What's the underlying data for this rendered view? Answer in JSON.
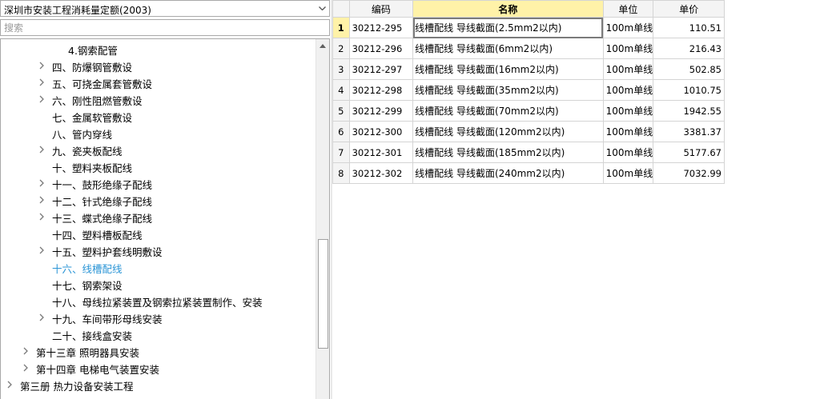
{
  "left": {
    "quota_selector": {
      "value": "深圳市安装工程消耗量定额(2003)"
    },
    "search": {
      "placeholder": "搜索",
      "value": ""
    },
    "tree": [
      {
        "label": "4.钢索配管",
        "level": 4,
        "expandable": false,
        "selected": false
      },
      {
        "label": "四、防爆钢管敷设",
        "level": 3,
        "expandable": true,
        "selected": false
      },
      {
        "label": "五、可挠金属套管敷设",
        "level": 3,
        "expandable": true,
        "selected": false
      },
      {
        "label": "六、刚性阻燃管敷设",
        "level": 3,
        "expandable": true,
        "selected": false
      },
      {
        "label": "七、金属软管敷设",
        "level": 3,
        "expandable": false,
        "selected": false
      },
      {
        "label": "八、管内穿线",
        "level": 3,
        "expandable": false,
        "selected": false
      },
      {
        "label": "九、瓷夹板配线",
        "level": 3,
        "expandable": true,
        "selected": false
      },
      {
        "label": "十、塑料夹板配线",
        "level": 3,
        "expandable": false,
        "selected": false
      },
      {
        "label": "十一、鼓形绝缘子配线",
        "level": 3,
        "expandable": true,
        "selected": false
      },
      {
        "label": "十二、针式绝缘子配线",
        "level": 3,
        "expandable": true,
        "selected": false
      },
      {
        "label": "十三、蝶式绝缘子配线",
        "level": 3,
        "expandable": true,
        "selected": false
      },
      {
        "label": "十四、塑料槽板配线",
        "level": 3,
        "expandable": false,
        "selected": false
      },
      {
        "label": "十五、塑料护套线明敷设",
        "level": 3,
        "expandable": true,
        "selected": false
      },
      {
        "label": "十六、线槽配线",
        "level": 3,
        "expandable": false,
        "selected": true
      },
      {
        "label": "十七、钢索架设",
        "level": 3,
        "expandable": false,
        "selected": false
      },
      {
        "label": "十八、母线拉紧装置及钢索拉紧装置制作、安装",
        "level": 3,
        "expandable": false,
        "selected": false
      },
      {
        "label": "十九、车间带形母线安装",
        "level": 3,
        "expandable": true,
        "selected": false
      },
      {
        "label": "二十、接线盒安装",
        "level": 3,
        "expandable": false,
        "selected": false
      },
      {
        "label": "第十三章 照明器具安装",
        "level": 2,
        "expandable": true,
        "selected": false
      },
      {
        "label": "第十四章 电梯电气装置安装",
        "level": 2,
        "expandable": true,
        "selected": false
      },
      {
        "label": "第三册 热力设备安装工程",
        "level": 1,
        "expandable": true,
        "selected": false
      }
    ]
  },
  "grid": {
    "headers": {
      "code": "编码",
      "name": "名称",
      "unit": "单位",
      "price": "单价"
    },
    "active_row": 1,
    "rows": [
      {
        "num": "1",
        "code": "30212-295",
        "name": "线槽配线 导线截面(2.5mm2以内)",
        "unit": "100m单线",
        "price": "110.51"
      },
      {
        "num": "2",
        "code": "30212-296",
        "name": "线槽配线 导线截面(6mm2以内)",
        "unit": "100m单线",
        "price": "216.43"
      },
      {
        "num": "3",
        "code": "30212-297",
        "name": "线槽配线 导线截面(16mm2以内)",
        "unit": "100m单线",
        "price": "502.85"
      },
      {
        "num": "4",
        "code": "30212-298",
        "name": "线槽配线 导线截面(35mm2以内)",
        "unit": "100m单线",
        "price": "1010.75"
      },
      {
        "num": "5",
        "code": "30212-299",
        "name": "线槽配线 导线截面(70mm2以内)",
        "unit": "100m单线",
        "price": "1942.55"
      },
      {
        "num": "6",
        "code": "30212-300",
        "name": "线槽配线 导线截面(120mm2以内)",
        "unit": "100m单线",
        "price": "3381.37"
      },
      {
        "num": "7",
        "code": "30212-301",
        "name": "线槽配线 导线截面(185mm2以内)",
        "unit": "100m单线",
        "price": "5177.67"
      },
      {
        "num": "8",
        "code": "30212-302",
        "name": "线槽配线 导线截面(240mm2以内)",
        "unit": "100m单线",
        "price": "7032.99"
      }
    ]
  },
  "colors": {
    "selected_tree_item": "#2b95d6",
    "header_highlight": "#fff2a8",
    "grid_border": "#d4d4d4"
  },
  "icons": {
    "combo_arrow": "chevron-down-icon",
    "tree_expander": "chevron-right-icon",
    "scroll_up": "scroll-up-icon"
  }
}
